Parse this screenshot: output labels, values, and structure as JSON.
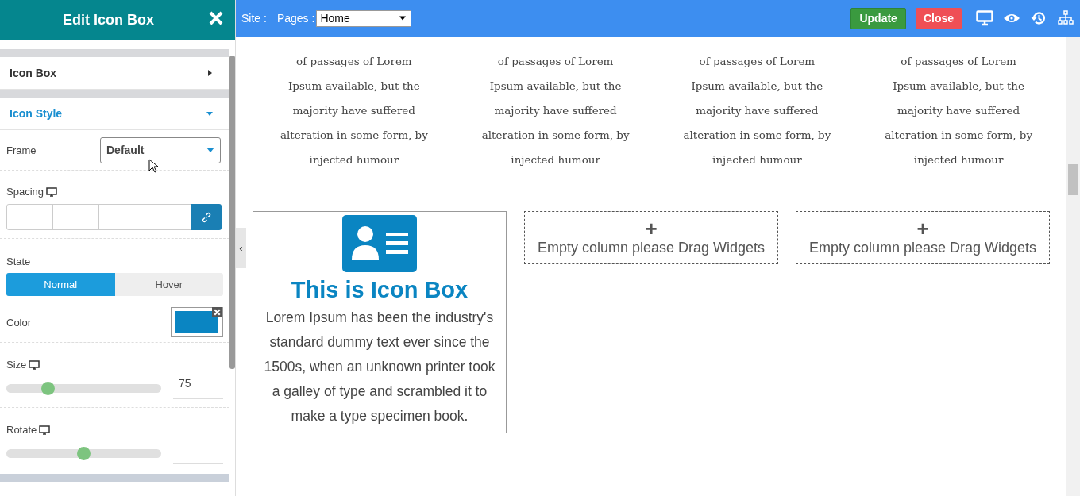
{
  "sidebar": {
    "title": "Edit Icon Box",
    "sections": [
      {
        "label": "Icon Box",
        "expanded": false
      },
      {
        "label": "Icon Style",
        "expanded": true
      }
    ],
    "frame": {
      "label": "Frame",
      "value": "Default"
    },
    "spacing": {
      "label": "Spacing"
    },
    "state": {
      "label": "State",
      "tabs": [
        {
          "label": "Normal",
          "selected": true
        },
        {
          "label": "Hover",
          "selected": false
        }
      ]
    },
    "color": {
      "label": "Color",
      "color": "#0a85c2"
    },
    "size": {
      "label": "Size",
      "level": 0.27,
      "value": "75"
    },
    "rotate": {
      "label": "Rotate",
      "level": 0.5
    }
  },
  "collapse": "‹",
  "topbar": {
    "site_label": "Site :",
    "pages_label": "Pages :",
    "page": "Home",
    "buttons": [
      {
        "label": "Update",
        "kind": "primary"
      },
      {
        "label": "Close",
        "kind": "danger"
      }
    ]
  },
  "columns": [
    {
      "lines": [
        "of passages of Lorem",
        "Ipsum available, but the",
        "majority have suffered",
        "alteration in some form, by",
        "injected humour"
      ]
    },
    {
      "lines": [
        "of passages of Lorem",
        "Ipsum available, but the",
        "majority have suffered",
        "alteration in some form, by",
        "injected humour"
      ]
    },
    {
      "lines": [
        "of passages of Lorem",
        "Ipsum available, but the",
        "majority have suffered",
        "alteration in some form, by",
        "injected humour"
      ]
    },
    {
      "lines": [
        "of passages of Lorem",
        "Ipsum available, but the",
        "majority have suffered",
        "alteration in some form, by",
        "injected humour"
      ]
    }
  ],
  "icon_box": {
    "title": "This is Icon Box",
    "lines": [
      "Lorem Ipsum has been the industry's",
      "standard dummy text ever since the",
      "1500s, when an unknown printer took",
      "a galley of type and scrambled it to",
      "make a type specimen book."
    ]
  },
  "empty_columns": [
    {
      "plus": "+",
      "text": "Empty column please Drag Widgets"
    },
    {
      "plus": "+",
      "text": "Empty column please Drag Widgets"
    }
  ]
}
